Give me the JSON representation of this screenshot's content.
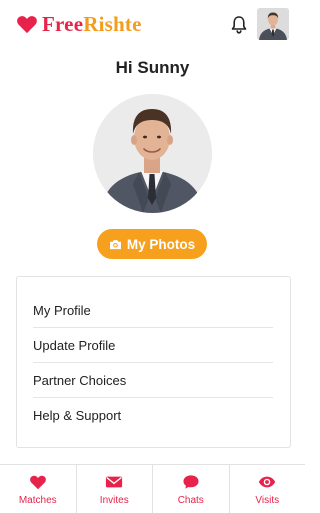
{
  "header": {
    "brand_part1": "Free",
    "brand_part2": "Rishte",
    "icons": {
      "logo": "heart-icon",
      "notifications": "bell-icon",
      "avatar": "user-avatar"
    }
  },
  "profile": {
    "greeting": "Hi Sunny",
    "photos_button": "My Photos",
    "photos_icon": "camera-icon"
  },
  "menu": {
    "items": [
      {
        "label": "My Profile"
      },
      {
        "label": "Update Profile"
      },
      {
        "label": "Partner Choices"
      },
      {
        "label": "Help & Support"
      }
    ]
  },
  "bottom_nav": {
    "items": [
      {
        "label": "Matches",
        "icon": "heart-icon"
      },
      {
        "label": "Invites",
        "icon": "envelope-icon"
      },
      {
        "label": "Chats",
        "icon": "chat-bubble-icon"
      },
      {
        "label": "Visits",
        "icon": "eye-icon"
      }
    ]
  },
  "colors": {
    "brand_red": "#e8234b",
    "brand_orange": "#f39c1d",
    "button_orange": "#f7a01d",
    "divider": "#e6e6e6"
  }
}
